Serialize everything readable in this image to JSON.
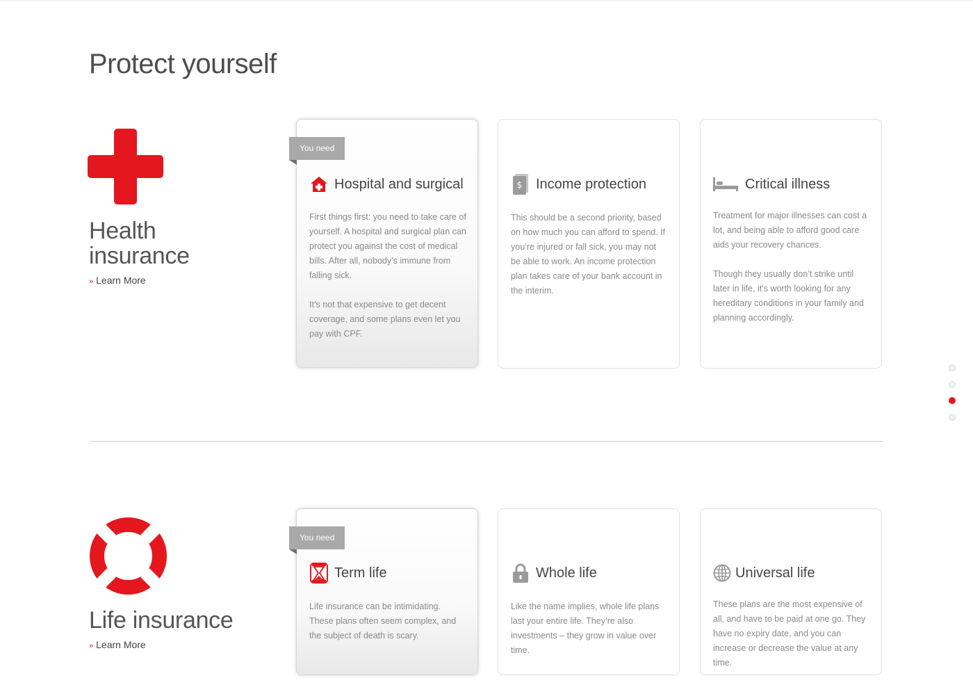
{
  "page": {
    "title": "Protect yourself"
  },
  "nav_dots": {
    "count": 4,
    "active_index": 2
  },
  "sections": [
    {
      "title_line1": "Health",
      "title_line2": "insurance",
      "icon": "red-cross-icon",
      "learn_more": "Learn More",
      "cards": [
        {
          "badge": "You need",
          "icon": "hospital-icon",
          "title": "Hospital and surgical",
          "paragraphs": [
            "First things first: you need to take care of yourself. A hospital and surgical plan can protect you against the cost of medical bills. After all, nobody’s immune from falling sick.",
            "It’s not that expensive to get decent coverage, and some plans even let you pay with CPF."
          ]
        },
        {
          "icon": "money-document-icon",
          "title": "Income protection",
          "paragraphs": [
            "This should be a second priority, based on how much you can afford to spend. If you’re injured or fall sick, you may not be able to work. An income protection plan takes care of your bank account in the interim."
          ]
        },
        {
          "icon": "bed-icon",
          "title": "Critical illness",
          "paragraphs": [
            "Treatment for major illnesses can cost a lot, and being able to afford good care aids your recovery chances.",
            "Though they usually don’t strike until later in life, it’s worth looking for any hereditary conditions in your family and planning accordingly."
          ]
        }
      ]
    },
    {
      "title_line1": "Life insurance",
      "icon": "lifebuoy-icon",
      "learn_more": "Learn More",
      "cards": [
        {
          "badge": "You need",
          "icon": "hourglass-icon",
          "title": "Term life",
          "paragraphs": [
            "Life insurance can be intimidating. These plans often seem complex, and the subject of death is scary."
          ]
        },
        {
          "icon": "padlock-icon",
          "title": "Whole life",
          "paragraphs": [
            "Like the name implies, whole life plans last your entire life. They’re also investments – they grow in value over time."
          ]
        },
        {
          "icon": "globe-icon",
          "title": "Universal life",
          "paragraphs": [
            "These plans are the most expensive of all, and have to be paid at one go. They have no expiry date, and you can increase or decrease the value at any time."
          ]
        }
      ]
    }
  ],
  "colors": {
    "accent": "#e4171e",
    "ribbon": "#a9a9a9",
    "icon_gray": "#9b9b9b"
  }
}
